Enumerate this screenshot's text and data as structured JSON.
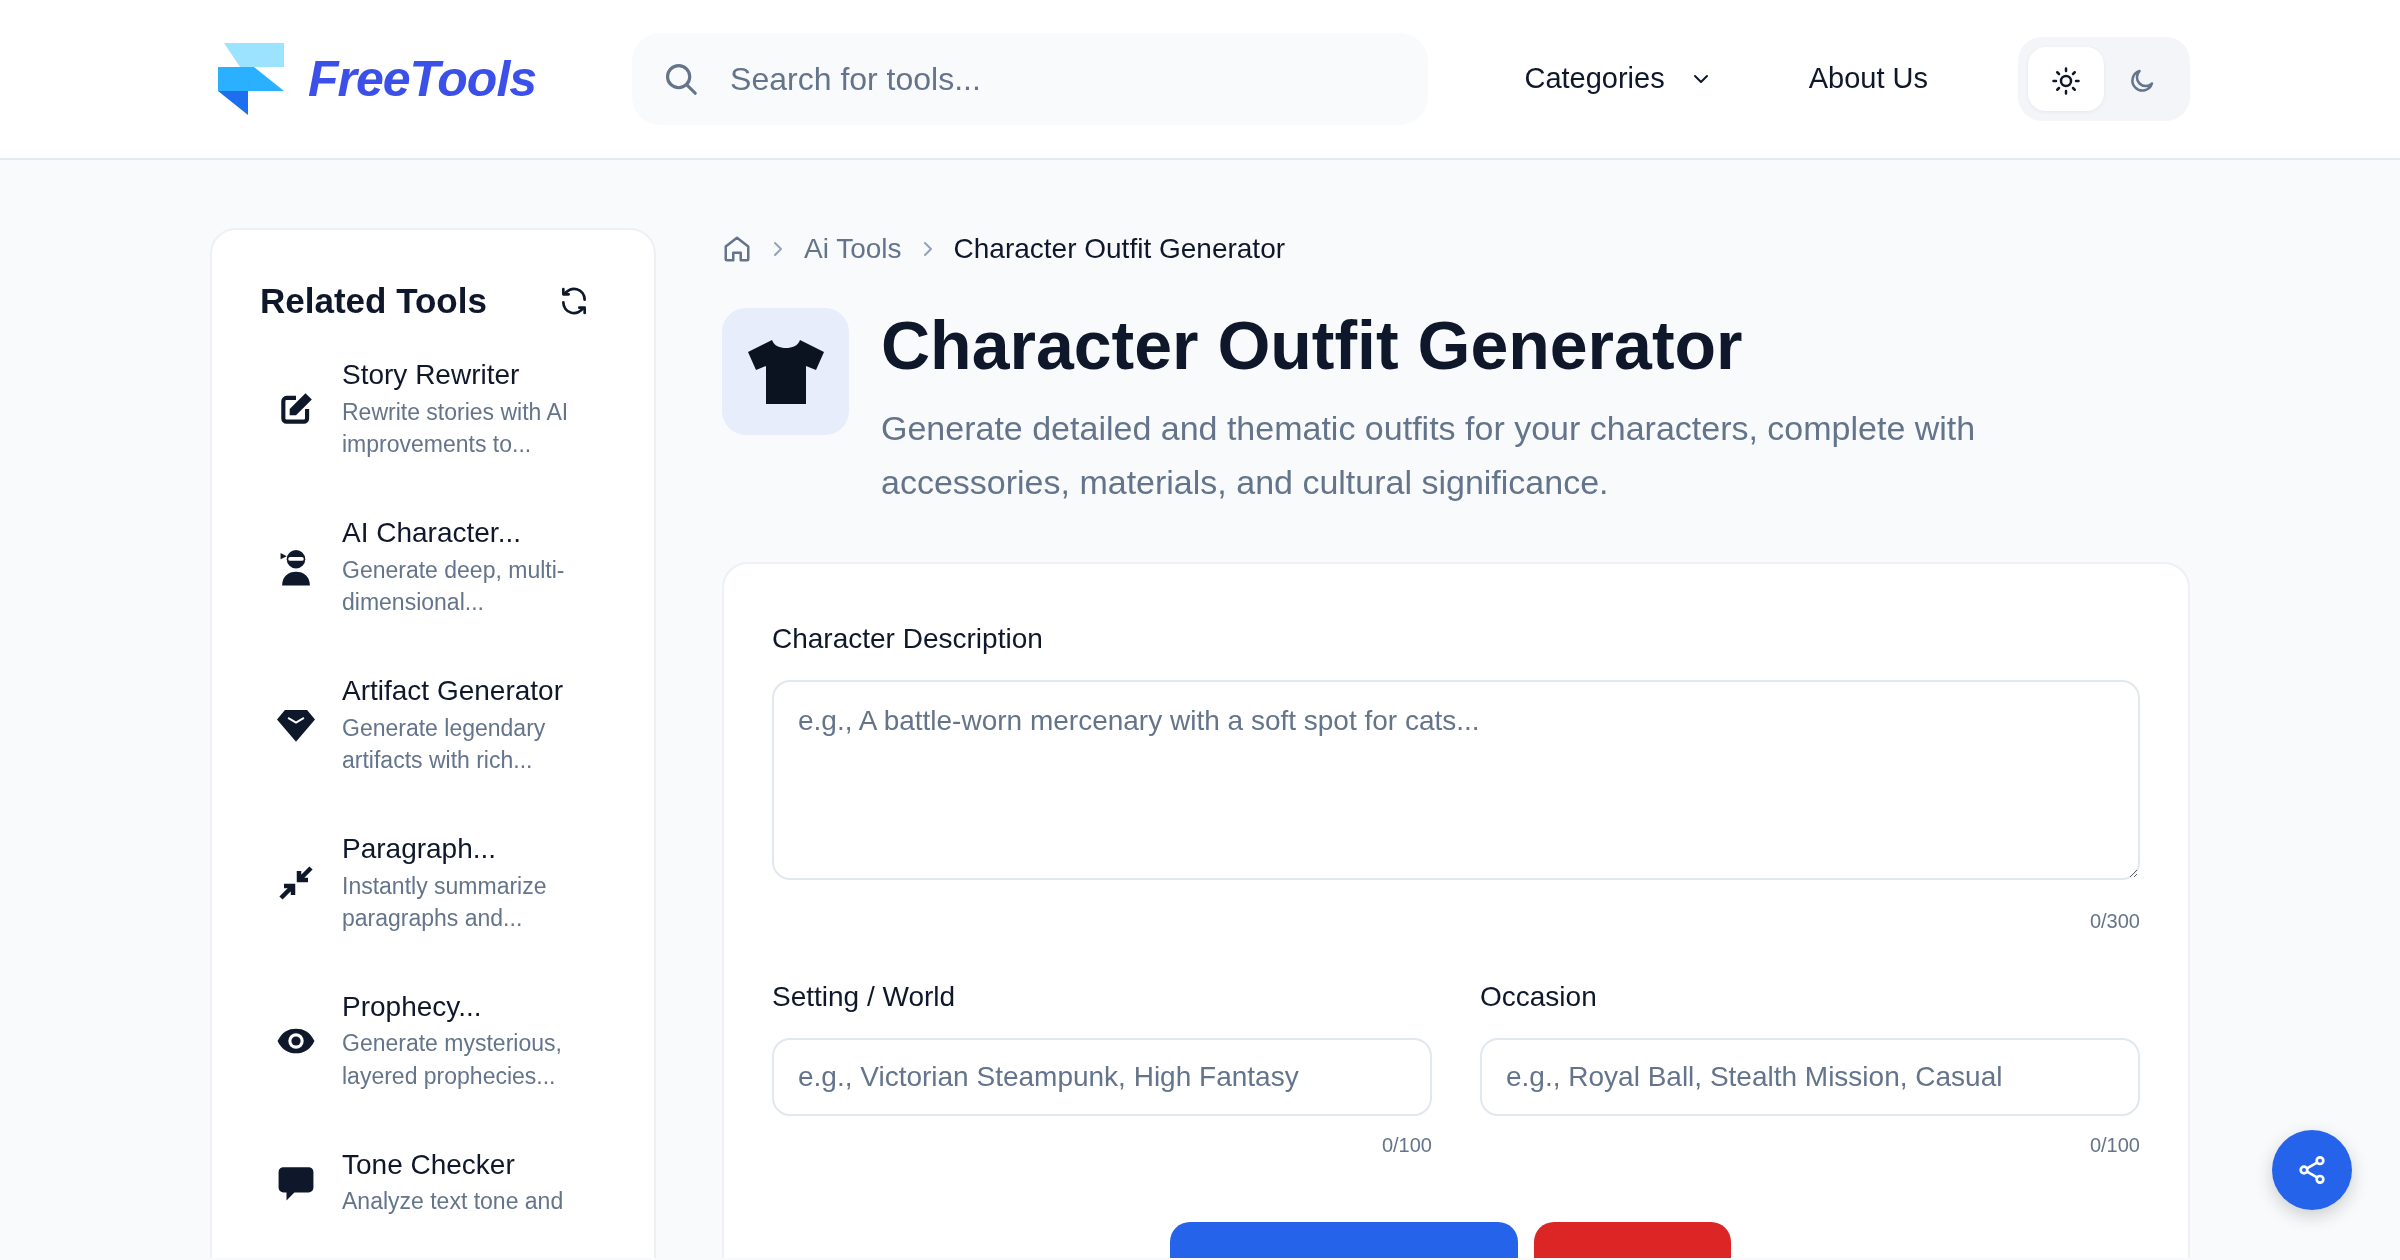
{
  "header": {
    "logo_text": "FreeTools",
    "search": {
      "placeholder": "Search for tools..."
    },
    "nav": [
      {
        "label": "Categories",
        "kind": "dropdown"
      },
      {
        "label": "About Us",
        "kind": "link"
      }
    ],
    "theme_toggle": [
      {
        "kind": "light",
        "selected": true
      },
      {
        "kind": "dark",
        "selected": false
      }
    ]
  },
  "sidebar": {
    "title": "Related Tools",
    "items": [
      {
        "title": "Story Rewriter",
        "description": "Rewrite stories with AI improvements to..."
      },
      {
        "title": "AI Character...",
        "description": "Generate deep, multi-dimensional..."
      },
      {
        "title": "Artifact Generator",
        "description": "Generate legendary artifacts with rich..."
      },
      {
        "title": "Paragraph...",
        "description": "Instantly summarize paragraphs and..."
      },
      {
        "title": "Prophecy...",
        "description": "Generate mysterious, layered prophecies..."
      },
      {
        "title": "Tone Checker",
        "description": "Analyze text tone and"
      }
    ]
  },
  "breadcrumb": [
    {
      "label": "Ai Tools"
    },
    {
      "label": "Character Outfit Generator"
    }
  ],
  "page": {
    "title": "Character Outfit Generator",
    "subtitle": "Generate detailed and thematic outfits for your characters, complete with accessories, materials, and cultural significance."
  },
  "form": {
    "fields": [
      {
        "kind": "textarea",
        "label": "Character Description",
        "placeholder": "e.g., A battle-worn mercenary with a soft spot for cats...",
        "counter": "0/300"
      },
      {
        "kind": "input",
        "label": "Setting / World",
        "placeholder": "e.g., Victorian Steampunk, High Fantasy",
        "counter": "0/100"
      },
      {
        "kind": "input",
        "label": "Occasion",
        "placeholder": "e.g., Royal Ball, Stealth Mission, Casual",
        "counter": "0/100"
      }
    ],
    "buttons": [
      {
        "kind": "primary"
      },
      {
        "kind": "danger"
      }
    ]
  }
}
